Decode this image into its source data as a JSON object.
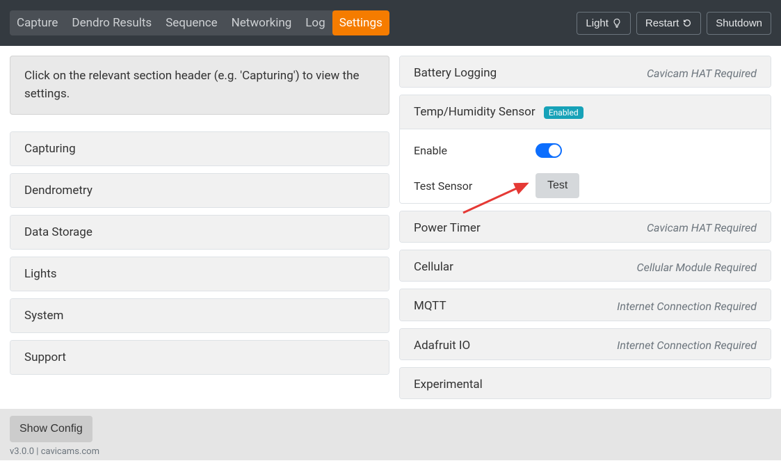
{
  "nav": {
    "items": [
      "Capture",
      "Dendro Results",
      "Sequence",
      "Networking",
      "Log",
      "Settings"
    ],
    "activeIndex": 5,
    "light": "Light",
    "restart": "Restart",
    "shutdown": "Shutdown"
  },
  "info": "Click on the relevant section header (e.g. 'Capturing') to view the settings.",
  "left_sections": [
    "Capturing",
    "Dendrometry",
    "Data Storage",
    "Lights",
    "System",
    "Support"
  ],
  "right": {
    "battery": {
      "title": "Battery Logging",
      "req": "Cavicam HAT Required"
    },
    "temp": {
      "title": "Temp/Humidity Sensor",
      "badge": "Enabled",
      "enable_label": "Enable",
      "test_label": "Test Sensor",
      "test_btn": "Test"
    },
    "power": {
      "title": "Power Timer",
      "req": "Cavicam HAT Required"
    },
    "cellular": {
      "title": "Cellular",
      "req": "Cellular Module Required"
    },
    "mqtt": {
      "title": "MQTT",
      "req": "Internet Connection Required"
    },
    "adafruit": {
      "title": "Adafruit IO",
      "req": "Internet Connection Required"
    },
    "experimental": {
      "title": "Experimental"
    }
  },
  "footer": {
    "show_config": "Show Config",
    "version": "v3.0.0 | cavicams.com"
  }
}
